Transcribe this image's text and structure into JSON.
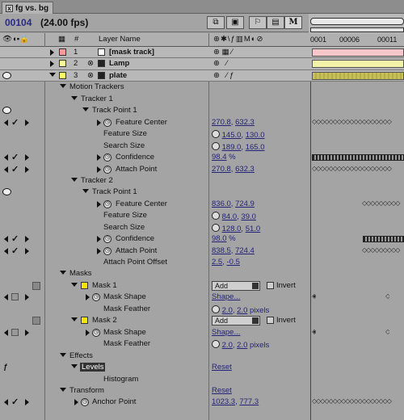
{
  "window": {
    "tab_title": "fg vs. bg",
    "close_glyph": "x"
  },
  "toolbar": {
    "timecode": "00104",
    "fps": "(24.00 fps)",
    "m_label": "M"
  },
  "header": {
    "layer_name": "Layer Name",
    "hash": "#"
  },
  "ruler": {
    "marks": [
      "0001",
      "00006",
      "00011"
    ]
  },
  "layers": [
    {
      "num": "1",
      "name": "[mask track]",
      "color": "#ff9999"
    },
    {
      "num": "2",
      "name": "Lamp",
      "color": "#ffff99"
    },
    {
      "num": "3",
      "name": "plate",
      "color": "#ffff66"
    }
  ],
  "tree": {
    "motion_trackers": "Motion Trackers",
    "tracker1": "Tracker 1",
    "tp1": "Track Point 1",
    "feature_center": "Feature Center",
    "feature_size": "Feature Size",
    "search_size": "Search Size",
    "confidence": "Confidence",
    "attach_point": "Attach Point",
    "tracker2": "Tracker 2",
    "tp1b": "Track Point 1",
    "attach_point_offset": "Attach Point Offset",
    "masks": "Masks",
    "mask1": "Mask 1",
    "mask_shape": "Mask Shape",
    "mask_feather": "Mask Feather",
    "mask2": "Mask 2",
    "effects": "Effects",
    "levels": "Levels",
    "histogram": "Histogram",
    "transform": "Transform",
    "anchor_point": "Anchor Point"
  },
  "values": {
    "t1_fc_a": "270.8",
    "t1_fc_b": "632.3",
    "t1_fs_a": "145.0",
    "t1_fs_b": "130.0",
    "t1_ss_a": "189.0",
    "t1_ss_b": "165.0",
    "t1_conf": "98.4",
    "pct": "%",
    "t1_ap_a": "270.8",
    "t1_ap_b": "632.3",
    "t2_fc_a": "836.0",
    "t2_fc_b": "724.9",
    "t2_fs_a": "84.0",
    "t2_fs_b": "39.0",
    "t2_ss_a": "128.0",
    "t2_ss_b": "51.0",
    "t2_conf": "98.0",
    "t2_ap_a": "838.5",
    "t2_ap_b": "724.4",
    "t2_apo_a": "2.5",
    "t2_apo_b": "-0.5",
    "mode": "Add",
    "invert": "Invert",
    "shape": "Shape...",
    "feather_a": "2.0",
    "feather_b": "2.0",
    "pixels": "pixels",
    "reset": "Reset",
    "anchor_a": "1023.3",
    "anchor_b": "777.3",
    "comma": ","
  }
}
